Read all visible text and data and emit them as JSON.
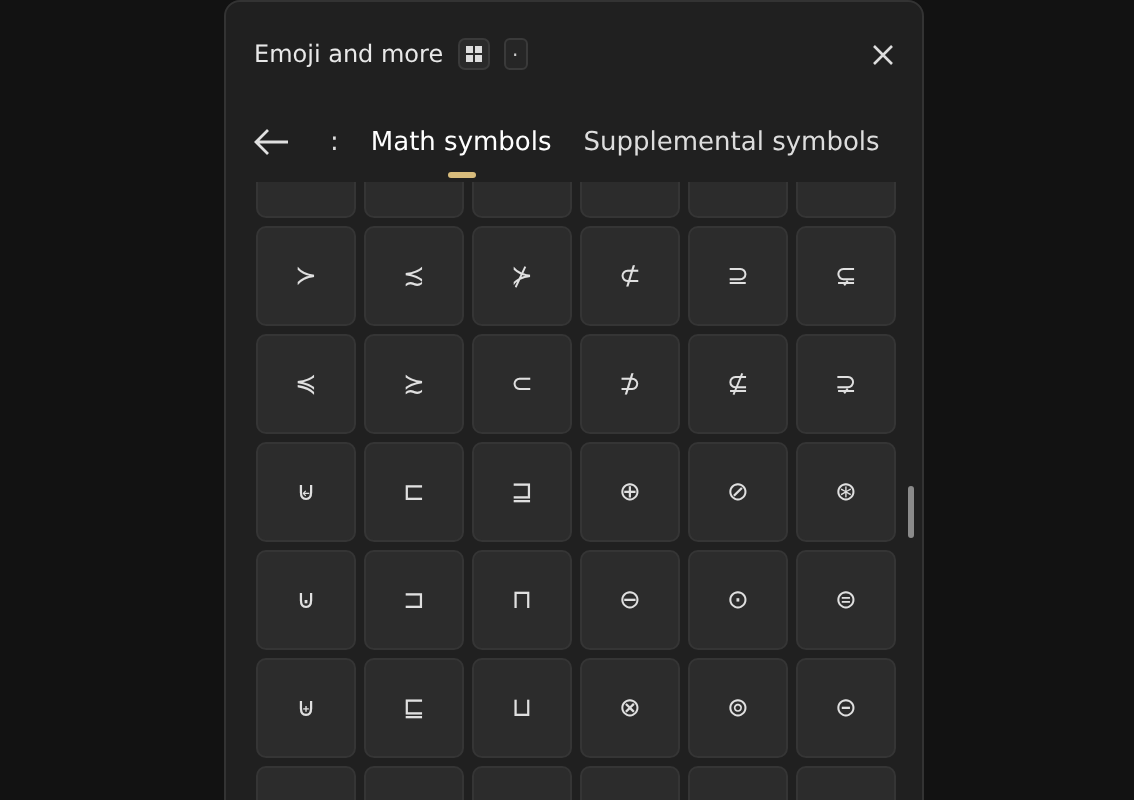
{
  "window": {
    "title": "Emoji and more",
    "keys": [
      "."
    ]
  },
  "tabs": [
    {
      "label": ":",
      "selected": false
    },
    {
      "label": "Math symbols",
      "selected": true
    },
    {
      "label": "Supplemental symbols",
      "selected": false
    }
  ],
  "symbols": [
    [
      "≻",
      "≾",
      "⊁",
      "⊄",
      "⊇",
      "⊊"
    ],
    [
      "≼",
      "≿",
      "⊂",
      "⊅",
      "⊈",
      "⊋"
    ],
    [
      "⊌",
      "⊏",
      "⊒",
      "⊕",
      "⊘",
      "⊛"
    ],
    [
      "⊍",
      "⊐",
      "⊓",
      "⊖",
      "⊙",
      "⊜"
    ],
    [
      "⊎",
      "⊑",
      "⊔",
      "⊗",
      "⊚",
      "⊝"
    ]
  ]
}
